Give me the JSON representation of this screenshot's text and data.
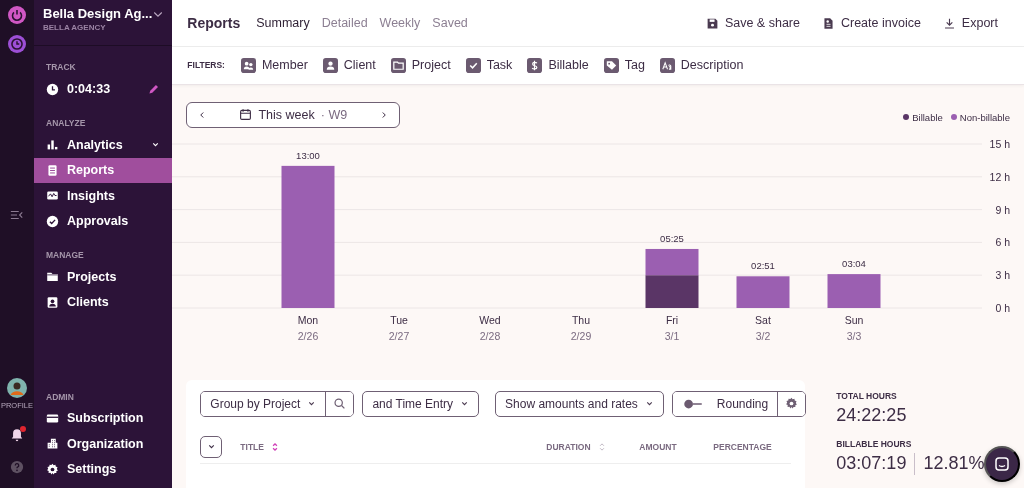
{
  "rail": {
    "profile_label": "PROFILE",
    "notifications": true
  },
  "workspace": {
    "name": "Bella Design Ag...",
    "subtitle": "BELLA AGENCY"
  },
  "sidebar": {
    "sections": [
      {
        "heading": "TRACK",
        "items": [
          {
            "kind": "timer",
            "label": "0:04:33"
          }
        ]
      },
      {
        "heading": "ANALYZE",
        "items": [
          {
            "kind": "group",
            "label": "Analytics",
            "selected": false
          },
          {
            "kind": "link",
            "label": "Reports",
            "selected": true
          },
          {
            "kind": "link",
            "label": "Insights",
            "selected": false
          },
          {
            "kind": "link",
            "label": "Approvals",
            "selected": false
          }
        ]
      },
      {
        "heading": "MANAGE",
        "items": [
          {
            "kind": "link",
            "label": "Projects",
            "selected": false
          },
          {
            "kind": "link",
            "label": "Clients",
            "selected": false
          }
        ]
      },
      {
        "heading": "ADMIN",
        "items": [
          {
            "kind": "link",
            "label": "Subscription",
            "selected": false
          },
          {
            "kind": "link",
            "label": "Organization",
            "selected": false
          },
          {
            "kind": "link",
            "label": "Settings",
            "selected": false
          }
        ]
      }
    ]
  },
  "header": {
    "title": "Reports",
    "tabs": [
      {
        "label": "Summary",
        "selected": true
      },
      {
        "label": "Detailed",
        "selected": false
      },
      {
        "label": "Weekly",
        "selected": false
      },
      {
        "label": "Saved",
        "selected": false
      }
    ],
    "actions": [
      "Save & share",
      "Create invoice",
      "Export"
    ]
  },
  "filters": {
    "label": "FILTERS:",
    "items": [
      "Member",
      "Client",
      "Project",
      "Task",
      "Billable",
      "Tag",
      "Description"
    ]
  },
  "chart": {
    "period": "This week",
    "week": "· W9",
    "chart_data": {
      "type": "bar",
      "stacked": true,
      "categories": [
        "Mon",
        "Tue",
        "Wed",
        "Thu",
        "Fri",
        "Sat",
        "Sun"
      ],
      "annotations": [
        "2/26",
        "2/27",
        "2/28",
        "2/29",
        "3/1",
        "3/2",
        "3/3"
      ],
      "grid": true,
      "series": [
        {
          "name": "Billable",
          "color": "#5a3566",
          "values": [
            0,
            0,
            0,
            0,
            3,
            0,
            0
          ]
        },
        {
          "name": "Non-billable",
          "color": "#9b5fb1",
          "values": [
            13,
            0,
            0,
            0,
            2.4,
            2.9,
            3.1
          ]
        }
      ],
      "ylim": [
        0,
        15
      ],
      "yticks": [
        {
          "value": 0,
          "label": "0 h"
        },
        {
          "value": 3,
          "label": "3 h"
        },
        {
          "value": 6,
          "label": "6 h"
        },
        {
          "value": 9,
          "label": "9 h"
        },
        {
          "value": 12,
          "label": "12 h"
        },
        {
          "value": 15,
          "label": "15 h"
        }
      ],
      "value_labels": [
        "13:00",
        null,
        null,
        null,
        "05:25",
        "02:51",
        "03:04"
      ]
    }
  },
  "table": {
    "group_by": "Group by Project",
    "sub_group": "and Time Entry",
    "display": "Show amounts and rates",
    "rounding": {
      "label": "Rounding",
      "on": false
    },
    "columns": [
      {
        "label": "TITLE",
        "sorted": true
      },
      {
        "label": "DURATION",
        "sorted": false
      },
      {
        "label": "AMOUNT"
      },
      {
        "label": "PERCENTAGE"
      }
    ]
  },
  "summary": {
    "total_label": "TOTAL HOURS",
    "total": "24:22:25",
    "billable_label": "BILLABLE HOURS",
    "billable": "03:07:19",
    "billable_percent": "12.81%"
  }
}
